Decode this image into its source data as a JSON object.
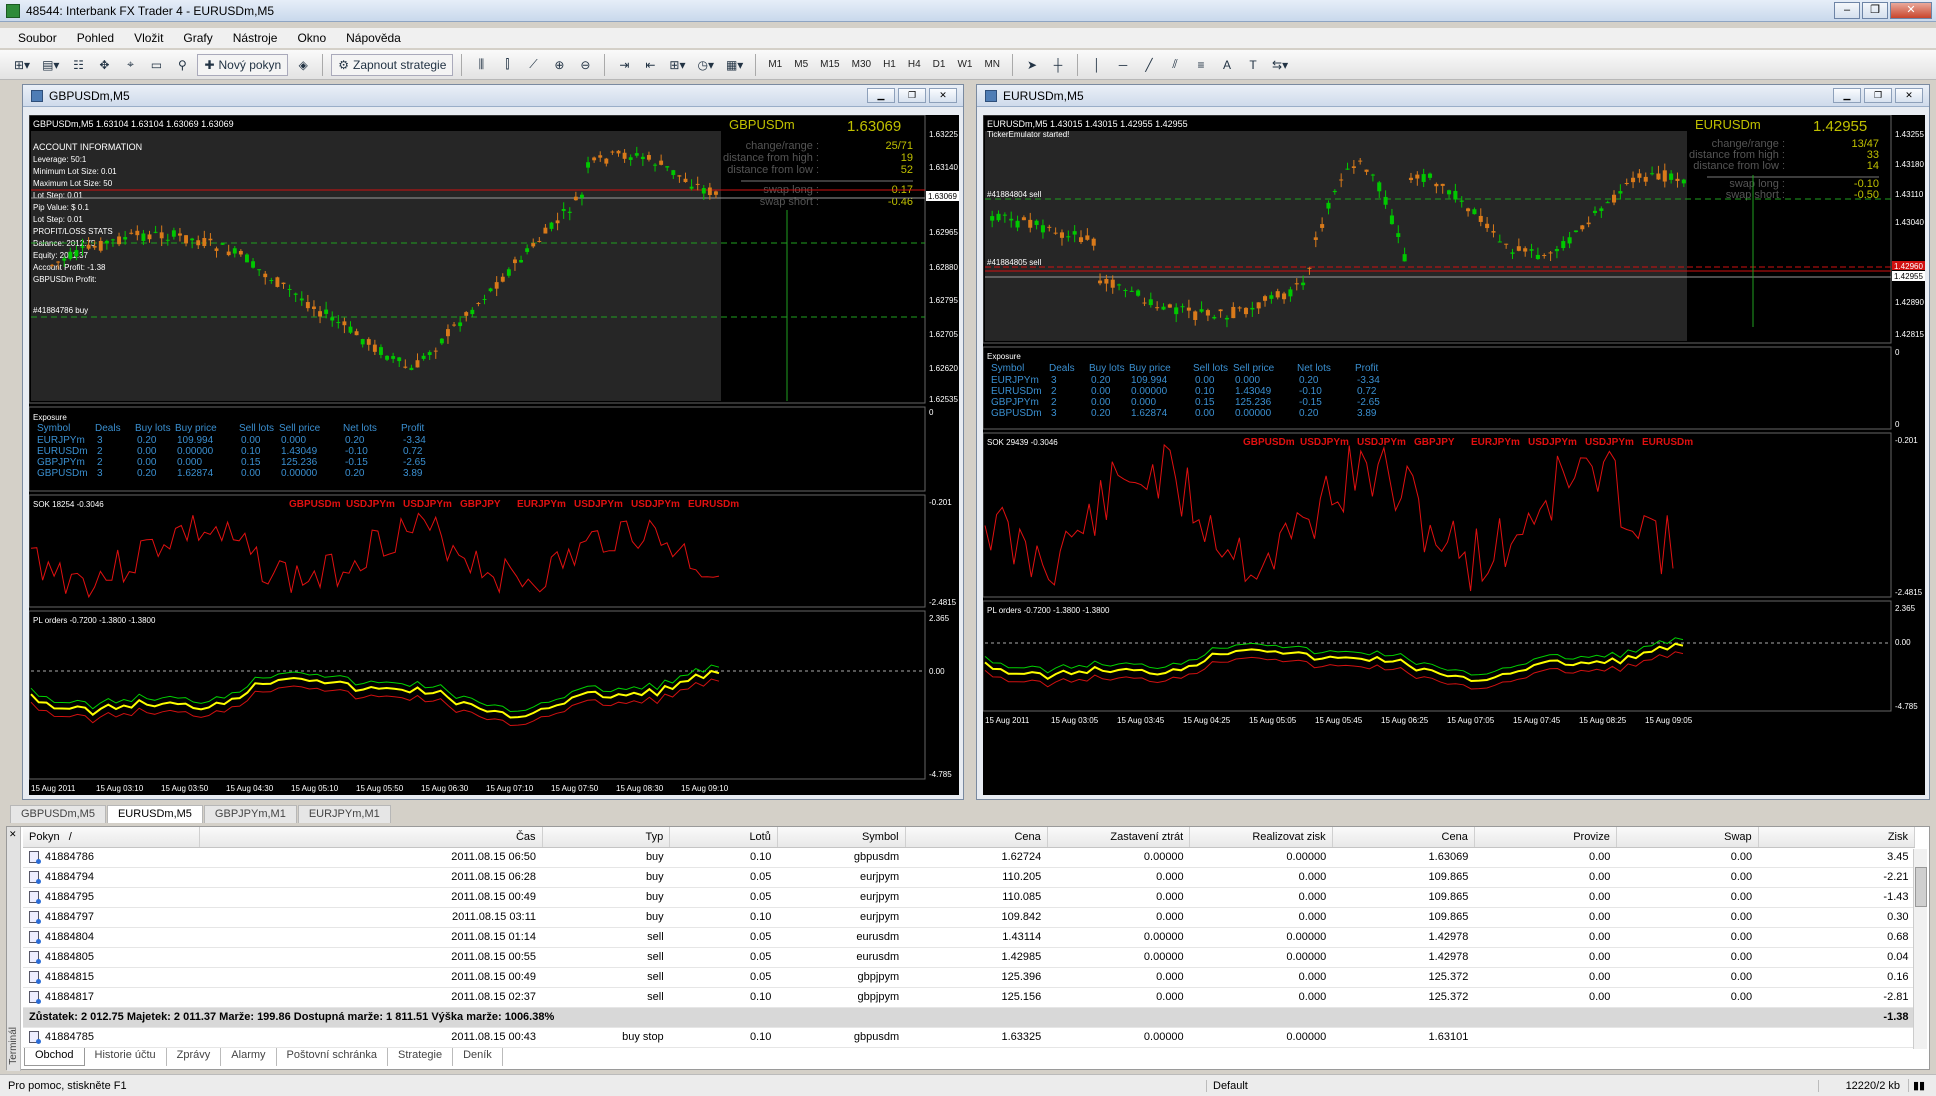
{
  "window": {
    "title": "48544: Interbank FX Trader 4 - EURUSDm,M5"
  },
  "menu": [
    "Soubor",
    "Pohled",
    "Vložit",
    "Grafy",
    "Nástroje",
    "Okno",
    "Nápověda"
  ],
  "toolbar": {
    "new_order": "Nový pokyn",
    "strategies": "Zapnout strategie",
    "timeframes": [
      "M1",
      "M5",
      "M15",
      "M30",
      "H1",
      "H4",
      "D1",
      "W1",
      "MN"
    ]
  },
  "left_chart": {
    "window_title": "GBPUSDm,M5",
    "header": "GBPUSDm,M5  1.63104 1.63104 1.63069 1.63069",
    "big_symbol": "GBPUSDm",
    "big_price": "1.63069",
    "stats": {
      "change_range_label": "change/range :",
      "change_range": "25/71",
      "dist_high_label": "distance from high :",
      "dist_high": "19",
      "dist_low_label": "distance from low :",
      "dist_low": "52",
      "swap_long_label": "swap long :",
      "swap_long": "-0.17",
      "swap_short_label": "swap short :",
      "swap_short": "-0.46"
    },
    "account_info": [
      "ACCOUNT INFORMATION",
      "Leverage: 50:1",
      "Minimum Lot Size: 0.01",
      "Maximum Lot Size: 50",
      "Lot Step: 0.01",
      "Pip Value: $ 0.1",
      "Lot Step: 0.01",
      "PROFIT/LOSS STATS",
      "Balance: 2012.75",
      "Equity: 2011.37",
      "Account Profit: -1.38",
      "GBPUSDm Profit:"
    ],
    "order_label": "#41884786 buy",
    "price_axis": [
      "1.63225",
      "1.63140",
      "1.63069",
      "1.62965",
      "1.62880",
      "1.62795",
      "1.62705",
      "1.62620",
      "1.62535"
    ],
    "sok_label": "SOK 18254 -0.3046",
    "sok_axis": [
      "-0.201",
      "-2.4815"
    ],
    "pl_label": "PL orders -0.7200 -1.3800 -1.3800",
    "pl_axis": [
      "2.365",
      "0.00",
      "-4.785"
    ],
    "time_axis": [
      "15 Aug 2011",
      "15 Aug 03:10",
      "15 Aug 03:50",
      "15 Aug 04:30",
      "15 Aug 05:10",
      "15 Aug 05:50",
      "15 Aug 06:30",
      "15 Aug 07:10",
      "15 Aug 07:50",
      "15 Aug 08:30",
      "15 Aug 09:10"
    ]
  },
  "right_chart": {
    "window_title": "EURUSDm,M5",
    "header": "EURUSDm,M5  1.43015 1.43015 1.42955 1.42955",
    "sub_header": "TickerEmulator started!",
    "big_symbol": "EURUSDm",
    "big_price": "1.42955",
    "stats": {
      "change_range_label": "change/range :",
      "change_range": "13/47",
      "dist_high_label": "distance from high :",
      "dist_high": "33",
      "dist_low_label": "distance from low :",
      "dist_low": "14",
      "swap_long_label": "swap long :",
      "swap_long": "-0.10",
      "swap_short_label": "swap short :",
      "swap_short": "-0.50"
    },
    "order_labels": [
      "#41884804 sell",
      "#41884805 sell"
    ],
    "price_axis": [
      "1.43255",
      "1.43180",
      "1.43110",
      "1.43040",
      "1.42960",
      "1.42955",
      "1.42890",
      "1.42815"
    ],
    "exposure_axis": [
      "0",
      "0"
    ],
    "sok_label": "SOK 29439 -0.3046",
    "sok_axis": [
      "-0.201",
      "-2.4815"
    ],
    "pl_label": "PL orders -0.7200 -1.3800 -1.3800",
    "pl_axis": [
      "2.365",
      "0.00",
      "-4.785"
    ],
    "time_axis": [
      "15 Aug 2011",
      "15 Aug 03:05",
      "15 Aug 03:45",
      "15 Aug 04:25",
      "15 Aug 05:05",
      "15 Aug 05:45",
      "15 Aug 06:25",
      "15 Aug 07:05",
      "15 Aug 07:45",
      "15 Aug 08:25",
      "15 Aug 09:05"
    ]
  },
  "exposure": {
    "title": "Exposure",
    "headers": [
      "Symbol",
      "Deals",
      "Buy lots",
      "Buy price",
      "Sell lots",
      "Sell price",
      "Net lots",
      "Profit"
    ],
    "rows": [
      [
        "EURJPYm",
        "3",
        "0.20",
        "109.994",
        "0.00",
        "0.000",
        "0.20",
        "-3.34"
      ],
      [
        "EURUSDm",
        "2",
        "0.00",
        "0.00000",
        "0.10",
        "1.43049",
        "-0.10",
        "0.72"
      ],
      [
        "GBPJPYm",
        "2",
        "0.00",
        "0.000",
        "0.15",
        "125.236",
        "-0.15",
        "-2.65"
      ],
      [
        "GBPUSDm",
        "3",
        "0.20",
        "1.62874",
        "0.00",
        "0.00000",
        "0.20",
        "3.89"
      ]
    ]
  },
  "sok_symbols": [
    "GBPUSDm",
    "USDJPYm",
    "USDJPYm",
    "GBPJPY",
    "EURJPYm",
    "USDJPYm",
    "USDJPYm",
    "EURUSDm"
  ],
  "chart_tabs": [
    "GBPUSDm,M5",
    "EURUSDm,M5",
    "GBPJPYm,M1",
    "EURJPYm,M1"
  ],
  "terminal": {
    "side_label": "Terminál",
    "headers": [
      "Pokyn",
      "Čas",
      "Typ",
      "Lotů",
      "Symbol",
      "Cena",
      "Zastavení ztrát",
      "Realizovat zisk",
      "Cena",
      "Provize",
      "Swap",
      "Zisk"
    ],
    "sort_mark": "/",
    "rows": [
      [
        "41884786",
        "2011.08.15 06:50",
        "buy",
        "0.10",
        "gbpusdm",
        "1.62724",
        "0.00000",
        "0.00000",
        "1.63069",
        "0.00",
        "0.00",
        "3.45"
      ],
      [
        "41884794",
        "2011.08.15 06:28",
        "buy",
        "0.05",
        "eurjpym",
        "110.205",
        "0.000",
        "0.000",
        "109.865",
        "0.00",
        "0.00",
        "-2.21"
      ],
      [
        "41884795",
        "2011.08.15 00:49",
        "buy",
        "0.05",
        "eurjpym",
        "110.085",
        "0.000",
        "0.000",
        "109.865",
        "0.00",
        "0.00",
        "-1.43"
      ],
      [
        "41884797",
        "2011.08.15 03:11",
        "buy",
        "0.10",
        "eurjpym",
        "109.842",
        "0.000",
        "0.000",
        "109.865",
        "0.00",
        "0.00",
        "0.30"
      ],
      [
        "41884804",
        "2011.08.15 01:14",
        "sell",
        "0.05",
        "eurusdm",
        "1.43114",
        "0.00000",
        "0.00000",
        "1.42978",
        "0.00",
        "0.00",
        "0.68"
      ],
      [
        "41884805",
        "2011.08.15 00:55",
        "sell",
        "0.05",
        "eurusdm",
        "1.42985",
        "0.00000",
        "0.00000",
        "1.42978",
        "0.00",
        "0.00",
        "0.04"
      ],
      [
        "41884815",
        "2011.08.15 00:49",
        "sell",
        "0.05",
        "gbpjpym",
        "125.396",
        "0.000",
        "0.000",
        "125.372",
        "0.00",
        "0.00",
        "0.16"
      ],
      [
        "41884817",
        "2011.08.15 02:37",
        "sell",
        "0.10",
        "gbpjpym",
        "125.156",
        "0.000",
        "0.000",
        "125.372",
        "0.00",
        "0.00",
        "-2.81"
      ]
    ],
    "summary": "Zůstatek: 2 012.75  Majetek: 2 011.37  Marže: 199.86  Dostupná marže: 1 811.51  Výška marže: 1006.38%",
    "summary_profit": "-1.38",
    "partial_row": [
      "41884785",
      "2011.08.15 00:43",
      "buy stop",
      "0.10",
      "gbpusdm",
      "1.63325",
      "0.00000",
      "0.00000",
      "1.63101"
    ],
    "tabs": [
      "Obchod",
      "Historie účtu",
      "Zprávy",
      "Alarmy",
      "Poštovní schránka",
      "Strategie",
      "Deník"
    ]
  },
  "status": {
    "help": "Pro pomoc, stiskněte F1",
    "profile": "Default",
    "traffic": "12220/2 kb"
  },
  "colors": {
    "bull": "#00c800",
    "bear": "#d97a1a",
    "sok": "#e01010",
    "pl_yellow": "#ffff00",
    "pl_green": "#00d000",
    "pl_red": "#d01010",
    "stat_text": "#c0c000"
  }
}
